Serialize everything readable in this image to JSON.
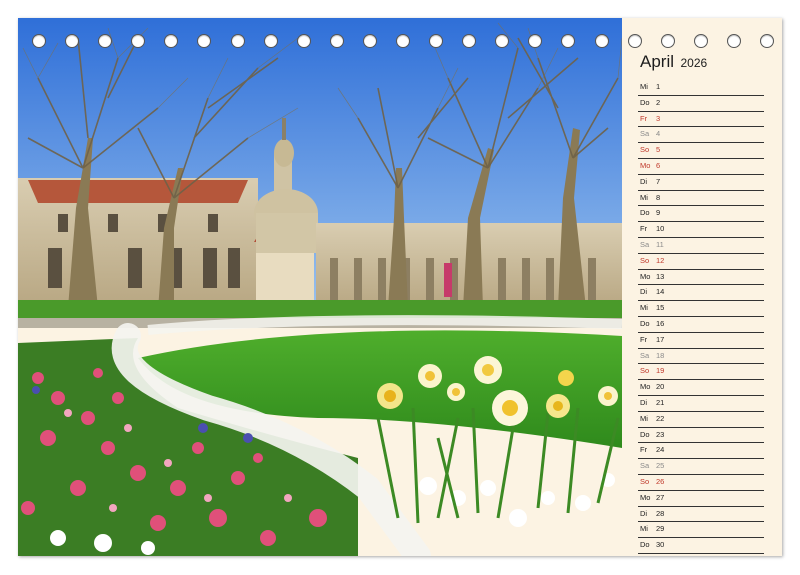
{
  "calendar": {
    "month": "April",
    "year": "2026",
    "days": [
      {
        "wd": "Mi",
        "d": "1",
        "kind": "day"
      },
      {
        "wd": "Do",
        "d": "2",
        "kind": "day"
      },
      {
        "wd": "Fr",
        "d": "3",
        "kind": "sun"
      },
      {
        "wd": "Sa",
        "d": "4",
        "kind": "sat"
      },
      {
        "wd": "So",
        "d": "5",
        "kind": "sun"
      },
      {
        "wd": "Mo",
        "d": "6",
        "kind": "sun"
      },
      {
        "wd": "Di",
        "d": "7",
        "kind": "day"
      },
      {
        "wd": "Mi",
        "d": "8",
        "kind": "day"
      },
      {
        "wd": "Do",
        "d": "9",
        "kind": "day"
      },
      {
        "wd": "Fr",
        "d": "10",
        "kind": "day"
      },
      {
        "wd": "Sa",
        "d": "11",
        "kind": "sat"
      },
      {
        "wd": "So",
        "d": "12",
        "kind": "sun"
      },
      {
        "wd": "Mo",
        "d": "13",
        "kind": "day"
      },
      {
        "wd": "Di",
        "d": "14",
        "kind": "day"
      },
      {
        "wd": "Mi",
        "d": "15",
        "kind": "day"
      },
      {
        "wd": "Do",
        "d": "16",
        "kind": "day"
      },
      {
        "wd": "Fr",
        "d": "17",
        "kind": "day"
      },
      {
        "wd": "Sa",
        "d": "18",
        "kind": "sat"
      },
      {
        "wd": "So",
        "d": "19",
        "kind": "sun"
      },
      {
        "wd": "Mo",
        "d": "20",
        "kind": "day"
      },
      {
        "wd": "Di",
        "d": "21",
        "kind": "day"
      },
      {
        "wd": "Mi",
        "d": "22",
        "kind": "day"
      },
      {
        "wd": "Do",
        "d": "23",
        "kind": "day"
      },
      {
        "wd": "Fr",
        "d": "24",
        "kind": "day"
      },
      {
        "wd": "Sa",
        "d": "25",
        "kind": "sat"
      },
      {
        "wd": "So",
        "d": "26",
        "kind": "sun"
      },
      {
        "wd": "Mo",
        "d": "27",
        "kind": "day"
      },
      {
        "wd": "Di",
        "d": "28",
        "kind": "day"
      },
      {
        "wd": "Mi",
        "d": "29",
        "kind": "day"
      },
      {
        "wd": "Do",
        "d": "30",
        "kind": "day"
      }
    ]
  },
  "binding": {
    "ring_count": 23
  },
  "photo": {
    "subject": "park-with-spring-flowers-and-domed-church"
  }
}
